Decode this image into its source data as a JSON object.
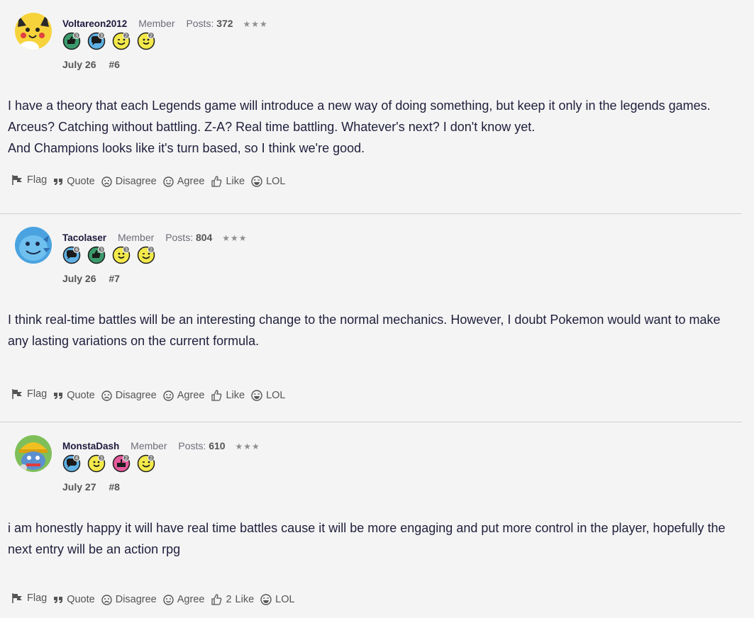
{
  "posts": [
    {
      "username": "Voltareon2012",
      "role": "Member",
      "posts_label": "Posts:",
      "posts_count": "372",
      "stars": "★★★",
      "date": "July 26",
      "number": "#6",
      "avatar": "pikachu-avatar",
      "badges": [
        {
          "icon": "thumbs-up-badge-icon",
          "color": "#3a9a6b",
          "level": "3"
        },
        {
          "icon": "comment-badge-icon",
          "color": "#5fb2e6",
          "level": "3"
        },
        {
          "icon": "wink-face-badge-icon",
          "color": "#f3e94b",
          "level": "2"
        },
        {
          "icon": "smile-face-badge-icon",
          "color": "#f3e94b",
          "level": "2"
        }
      ],
      "paragraphs": [
        "I have a theory that each Legends game will introduce a new way of doing something, but keep it only in the legends games. Arceus? Catching without battling. Z-A? Real time battling. Whatever's next? I don't know yet.",
        "And Champions looks like it's turn based, so I think we're good."
      ],
      "reactions": {
        "flag": "Flag",
        "quote": "Quote",
        "disagree": "Disagree",
        "agree": "Agree",
        "like": "Like",
        "like_count": "",
        "lol": "LOL"
      }
    },
    {
      "username": "Tacolaser",
      "role": "Member",
      "posts_label": "Posts:",
      "posts_count": "804",
      "stars": "★★★",
      "date": "July 26",
      "number": "#7",
      "avatar": "wooper-avatar",
      "badges": [
        {
          "icon": "comment-badge-icon",
          "color": "#5fb2e6",
          "level": "4"
        },
        {
          "icon": "thumbs-up-badge-icon",
          "color": "#3a9a6b",
          "level": "3"
        },
        {
          "icon": "smile-face-badge-icon",
          "color": "#f3e94b",
          "level": "3"
        },
        {
          "icon": "wink-face-badge-icon",
          "color": "#f3e94b",
          "level": "2"
        }
      ],
      "paragraphs": [
        "I think real-time battles will be an interesting change to the normal mechanics. However, I doubt Pokemon would want to make any lasting variations on the current formula."
      ],
      "reactions": {
        "flag": "Flag",
        "quote": "Quote",
        "disagree": "Disagree",
        "agree": "Agree",
        "like": "Like",
        "like_count": "",
        "lol": "LOL"
      }
    },
    {
      "username": "MonstaDash",
      "role": "Member",
      "posts_label": "Posts:",
      "posts_count": "610",
      "stars": "★★★",
      "date": "July 27",
      "number": "#8",
      "avatar": "clawitzer-avatar",
      "badges": [
        {
          "icon": "comment-badge-icon",
          "color": "#5fb2e6",
          "level": "4"
        },
        {
          "icon": "smile-face-badge-icon",
          "color": "#f3e94b",
          "level": "3"
        },
        {
          "icon": "cake-badge-icon",
          "color": "#e55a9c",
          "level": "2"
        },
        {
          "icon": "wink-face-badge-icon",
          "color": "#f3e94b",
          "level": "2"
        }
      ],
      "paragraphs": [
        "i am honestly happy it will have real time battles cause it will be more engaging and put more control in the player, hopefully the next entry will be an action rpg"
      ],
      "reactions": {
        "flag": "Flag",
        "quote": "Quote",
        "disagree": "Disagree",
        "agree": "Agree",
        "like": "Like",
        "like_count": "2",
        "lol": "LOL"
      }
    }
  ]
}
